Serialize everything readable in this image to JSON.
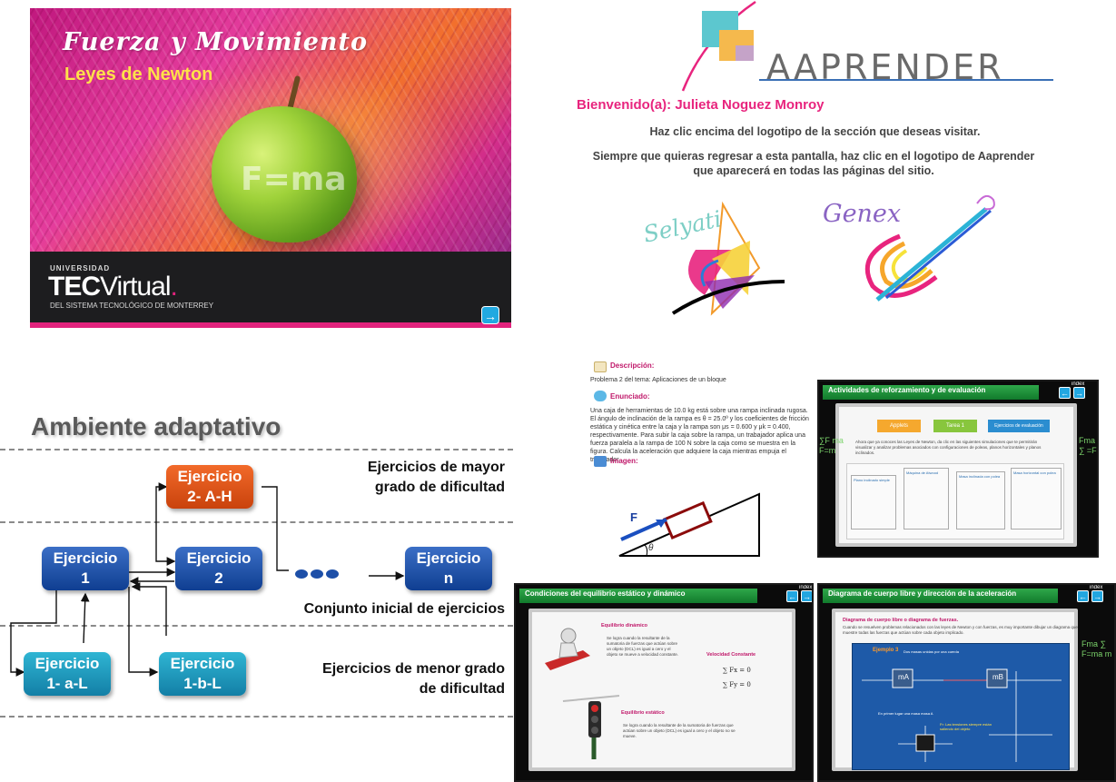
{
  "cover": {
    "title": "Fuerza y Movimiento",
    "subtitle": "Leyes de Newton",
    "formula": "F=ma",
    "university_label": "UNIVERSIDAD",
    "brand_tec": "TEC",
    "brand_virtual": "Virtual",
    "brand_mark": ".",
    "system_label": "DEL SISTEMA TECNOLÓGICO DE MONTERREY",
    "next_icon": "→",
    "colors": {
      "pink": "#e2237d",
      "yellow": "#ffe14a",
      "band": "#1d1d1f",
      "arrow": "#21a9e1"
    }
  },
  "aaprender": {
    "brand": "Aaprender",
    "brand_display": "AAPRENDER",
    "welcome": "Bienvenido(a): Julieta Noguez Monroy",
    "instruction": "Haz clic encima del logotipo de la sección que deseas visitar.",
    "return_note": "Siempre que quieras regresar a esta pantalla, haz clic en el logotipo de Aaprender que aparecerá en todas las páginas del sitio.",
    "sections": [
      {
        "name": "Selyati",
        "icon": "selyati-logo"
      },
      {
        "name": "Genex",
        "icon": "genex-logo"
      }
    ],
    "colors": {
      "welcome": "#e8247e",
      "accent": "#3a6fb5"
    }
  },
  "adaptive": {
    "heading": "Ambiente adaptativo",
    "boxes": {
      "hard": [
        "Ejercicio",
        "2- A-H"
      ],
      "e1": [
        "Ejercicio",
        "1"
      ],
      "e2": [
        "Ejercicio",
        "2"
      ],
      "en": [
        "Ejercicio",
        "n"
      ],
      "e1a": [
        "Ejercicio",
        "1- a-L"
      ],
      "e1b": [
        "Ejercicio",
        "1-b-L"
      ]
    },
    "labels": {
      "harder": [
        "Ejercicios de mayor",
        "grado de dificultad"
      ],
      "initial": "Conjunto inicial de ejercicios",
      "easier": [
        "Ejercicios de menor grado",
        "de dificultad"
      ]
    },
    "colors": {
      "blue": "#1a4da0",
      "orange": "#e0561a",
      "teal": "#1f9bc2"
    }
  },
  "problem": {
    "description_label": "Descripción:",
    "description": "Problema 2 del tema: Aplicaciones de un bloque",
    "statement_label": "Enunciado:",
    "statement": "Una caja de herramientas de 10.0 kg está sobre una rampa inclinada rugosa. El ángulo de inclinación de la rampa es θ = 25.0º y los coeficientes de fricción estática y cinética entre la caja y la rampa son μs = 0.600 y μk = 0.400, respectivamente. Para subir la caja sobre la rampa, un trabajador aplica una fuerza paralela a la rampa de 100 N sobre la caja como se muestra en la figura. Calcula la aceleración que adquiere la caja mientras empuja el trabajador.",
    "image_label": "Imagen:",
    "force_label": "F",
    "angle_label": "θ"
  },
  "whiteboards": {
    "activities": {
      "title": "Actividades de reforzamiento y de evaluación",
      "tabs": [
        "Applets",
        "Tarea 1",
        "Ejercicios de evaluación"
      ],
      "intro": "Ahora que ya conoces las Leyes de Newton, da clic en las siguientes simulaciones que te permitirán visualizar y analizar problemas asociados con configuraciones de poleas, planos horizontales y planos inclinados.",
      "cards": [
        "Plano inclinado simple",
        "Máquina de Atwood",
        "Masa inclinada con polea",
        "Masa horizontal con polea"
      ]
    },
    "equilibrium": {
      "title": "Condiciones del equilibrio estático y dinámico",
      "dynamic_label": "Equilibrio dinámico",
      "dynamic_text": "Se logra cuando la resultante de la sumatoria de fuerzas que actúan sobre un objeto (DCL) es igual a cero y el objeto se mueve a velocidad constante.",
      "velocity_label": "Velocidad Constante",
      "eq1": "∑ Fx = 0",
      "eq2": "∑ Fy = 0",
      "static_label": "Equilibrio estático",
      "static_text": "Se logra cuando la resultante de la sumatoria de fuerzas que actúan sobre un objeto (DCL) es igual a cero y el objeto no se mueve."
    },
    "freebody": {
      "title": "Diagrama de cuerpo libre y dirección de la aceleración",
      "heading": "Diagrama de cuerpo libre o diagrama de fuerzas.",
      "text": "Cuando se resuelven problemas relacionados con las leyes de Newton y con fuerzas, es muy importante dibujar un diagrama que muestre todas las fuerzas que actúan sobre cada objeto implicado.",
      "example": "Ejemplo 3",
      "example_text": "Dos masas unidas por una cuerda",
      "mass_a": "mA",
      "mass_b": "mB",
      "note": "En primer lugar una masa masa A",
      "note2": "Fr: Las tensiones siempre están saliendo del objeto"
    },
    "index_label": "index",
    "nav": [
      "←",
      "→"
    ]
  }
}
